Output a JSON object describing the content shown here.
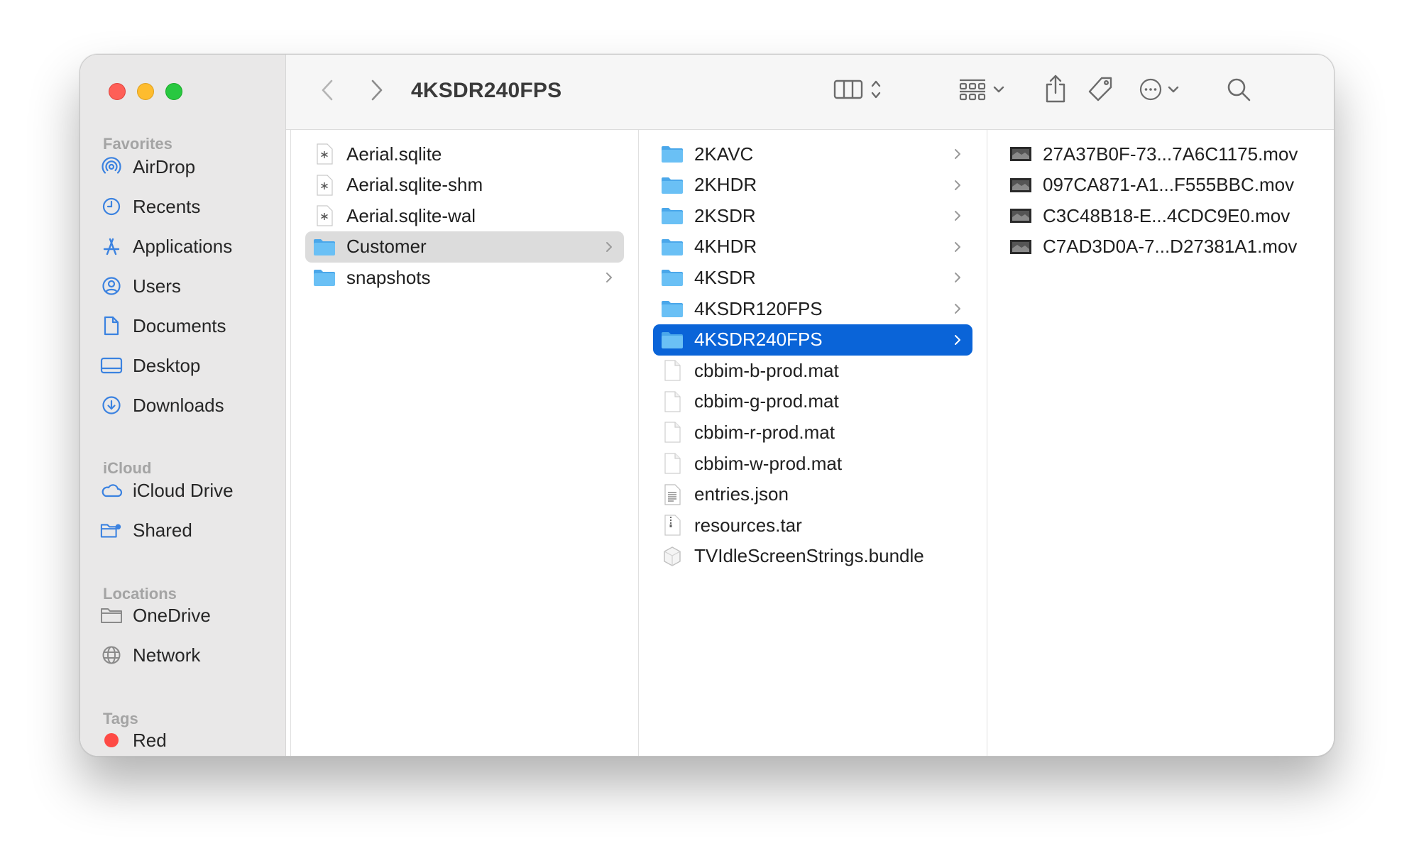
{
  "window": {
    "title": "4KSDR240FPS"
  },
  "colors": {
    "accent": "#0a64d8",
    "folder": "#5ab4f0",
    "traffic_close": "#fe5f57",
    "traffic_minimize": "#febc2e",
    "traffic_zoom": "#28c840",
    "tag_red": "#fe4a45"
  },
  "sidebar": {
    "favorites_title": "Favorites",
    "favorites": [
      {
        "label": "AirDrop",
        "icon": "airdrop-icon"
      },
      {
        "label": "Recents",
        "icon": "clock-icon"
      },
      {
        "label": "Applications",
        "icon": "applications-icon"
      },
      {
        "label": "Users",
        "icon": "user-icon"
      },
      {
        "label": "Documents",
        "icon": "document-icon"
      },
      {
        "label": "Desktop",
        "icon": "desktop-icon"
      },
      {
        "label": "Downloads",
        "icon": "download-icon"
      }
    ],
    "icloud_title": "iCloud",
    "icloud": [
      {
        "label": "iCloud Drive",
        "icon": "cloud-icon"
      },
      {
        "label": "Shared",
        "icon": "shared-folder-icon"
      }
    ],
    "locations_title": "Locations",
    "locations": [
      {
        "label": "OneDrive",
        "icon": "folder-icon"
      },
      {
        "label": "Network",
        "icon": "globe-icon"
      }
    ],
    "tags_title": "Tags",
    "tags": [
      {
        "label": "Red",
        "color": "#fe4a45"
      }
    ]
  },
  "toolbar": {
    "back_icon": "chevron-left-icon",
    "forward_icon": "chevron-right-icon",
    "view_icon": "column-view-icon",
    "group_icon": "group-icon",
    "share_icon": "share-icon",
    "tag_icon": "tag-icon",
    "more_icon": "ellipsis-icon",
    "search_icon": "search-icon"
  },
  "columns": [
    {
      "items": [
        {
          "name": "Aerial.sqlite",
          "kind": "sqlite"
        },
        {
          "name": "Aerial.sqlite-shm",
          "kind": "sqlite"
        },
        {
          "name": "Aerial.sqlite-wal",
          "kind": "sqlite"
        },
        {
          "name": "Customer",
          "kind": "folder",
          "selected": "inactive"
        },
        {
          "name": "snapshots",
          "kind": "folder"
        }
      ]
    },
    {
      "items": [
        {
          "name": "2KAVC",
          "kind": "folder"
        },
        {
          "name": "2KHDR",
          "kind": "folder"
        },
        {
          "name": "2KSDR",
          "kind": "folder"
        },
        {
          "name": "4KHDR",
          "kind": "folder"
        },
        {
          "name": "4KSDR",
          "kind": "folder"
        },
        {
          "name": "4KSDR120FPS",
          "kind": "folder"
        },
        {
          "name": "4KSDR240FPS",
          "kind": "folder",
          "selected": "active"
        },
        {
          "name": "cbbim-b-prod.mat",
          "kind": "file"
        },
        {
          "name": "cbbim-g-prod.mat",
          "kind": "file"
        },
        {
          "name": "cbbim-r-prod.mat",
          "kind": "file"
        },
        {
          "name": "cbbim-w-prod.mat",
          "kind": "file"
        },
        {
          "name": "entries.json",
          "kind": "json"
        },
        {
          "name": "resources.tar",
          "kind": "tar"
        },
        {
          "name": "TVIdleScreenStrings.bundle",
          "kind": "bundle"
        }
      ]
    },
    {
      "items": [
        {
          "name": "27A37B0F-73...7A6C1175.mov",
          "kind": "movie"
        },
        {
          "name": "097CA871-A1...F555BBC.mov",
          "kind": "movie"
        },
        {
          "name": "C3C48B18-E...4CDC9E0.mov",
          "kind": "movie"
        },
        {
          "name": "C7AD3D0A-7...D27381A1.mov",
          "kind": "movie"
        }
      ]
    }
  ]
}
